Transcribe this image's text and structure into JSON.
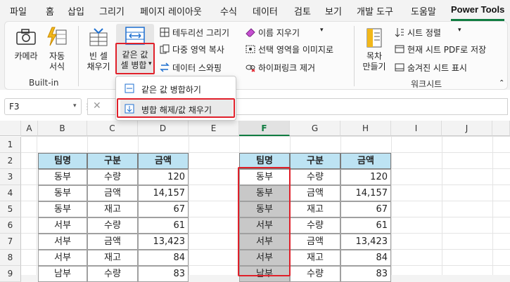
{
  "menu": {
    "items": [
      "파일",
      "홈",
      "삽입",
      "그리기",
      "페이지 레이아웃",
      "수식",
      "데이터",
      "검토",
      "보기",
      "개발 도구",
      "도움말",
      "Power Tools"
    ],
    "active": "Power Tools"
  },
  "ribbon": {
    "camera": "카메라",
    "auto_l1": "자동",
    "auto_l2": "서식",
    "builtin_group": "Built-in",
    "fill_blank_l1": "빈 셀",
    "fill_blank_l2": "채우기",
    "merge_l1": "같은 값",
    "merge_l2": "셀 병합",
    "border_draw": "테두리선 그리기",
    "multi_copy": "다중 영역 복사",
    "data_swap": "데이터 스와핑",
    "remove_name": "이름 지우기",
    "selection_image": "선택 영역을 이미지로",
    "remove_hyperlink": "하이퍼링크 제거",
    "toc_l1": "목차",
    "toc_l2": "만들기",
    "sheet_sort": "시트 정렬",
    "sheet_pdf": "현재 시트 PDF로 저장",
    "show_hidden": "숨겨진 시트 표시",
    "workbook_group": "워크시트"
  },
  "dropdown": {
    "merge_same": "같은 값 병합하기",
    "unmerge_fill": "병합 해제/값 채우기"
  },
  "formula_bar": {
    "cell_ref": "F3",
    "formula": ""
  },
  "columns": [
    "A",
    "B",
    "C",
    "D",
    "E",
    "F",
    "G",
    "H",
    "I",
    "J"
  ],
  "selected_column": "F",
  "rows": [
    "1",
    "2",
    "3",
    "4",
    "5",
    "6",
    "7",
    "8",
    "9"
  ],
  "left_table": {
    "headers": [
      "팀명",
      "구분",
      "금액"
    ],
    "rows": [
      [
        "동부",
        "수량",
        "120"
      ],
      [
        "동부",
        "금액",
        "14,157"
      ],
      [
        "동부",
        "재고",
        "67"
      ],
      [
        "서부",
        "수량",
        "61"
      ],
      [
        "서부",
        "금액",
        "13,423"
      ],
      [
        "서부",
        "재고",
        "84"
      ],
      [
        "남부",
        "수량",
        "83"
      ]
    ]
  },
  "right_table": {
    "headers": [
      "팀명",
      "구분",
      "금액"
    ],
    "rows": [
      [
        "동부",
        "수량",
        "120"
      ],
      [
        "동부",
        "금액",
        "14,157"
      ],
      [
        "동부",
        "재고",
        "67"
      ],
      [
        "서부",
        "수량",
        "61"
      ],
      [
        "서부",
        "금액",
        "13,423"
      ],
      [
        "서부",
        "재고",
        "84"
      ],
      [
        "남부",
        "수량",
        "83"
      ]
    ]
  },
  "colors": {
    "header_fill": "#bde3f3",
    "selection_gray": "#c8c8c8",
    "highlight_red": "#e0202a",
    "excel_green": "#107c41"
  }
}
